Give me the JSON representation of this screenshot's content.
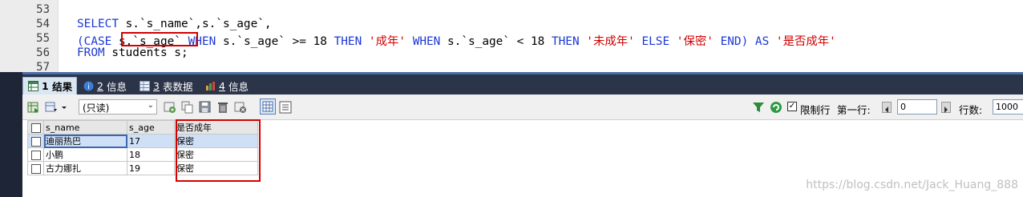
{
  "editor": {
    "line_numbers": [
      "53",
      "54",
      "55",
      "56",
      "57"
    ],
    "line54": {
      "kw1": "SELECT",
      "rest": " s.`s_name`,s.`s_age`,"
    },
    "line55": {
      "p1": "(CASE ",
      "boxed": "s.`s_age`",
      "kw_when1": " WHEN",
      "t1": " s.`s_age` >= 18 ",
      "kw_then1": "THEN",
      "s1": " '成年'",
      "kw_when2": " WHEN",
      "t2": " s.`s_age` < 18 ",
      "kw_then2": "THEN",
      "s2": " '未成年'",
      "kw_else": " ELSE",
      "s3": " '保密'",
      "kw_end": " END)",
      "kw_as": " AS",
      "s4": " '是否成年'"
    },
    "line56": {
      "kw": "FROM",
      "rest": " students s;"
    }
  },
  "tabs": [
    {
      "num": "1",
      "label": "结果",
      "icon": "grid-icon"
    },
    {
      "num": "2",
      "label": "信息",
      "icon": "info-icon"
    },
    {
      "num": "3",
      "label": "表数据",
      "icon": "table-icon"
    },
    {
      "num": "4",
      "label": "信息",
      "icon": "chart-icon"
    }
  ],
  "toolbar": {
    "readonly_label": "(只读)",
    "limit_label": "限制行",
    "first_row_label": "第一行:",
    "first_row_value": "0",
    "rows_label": "行数:",
    "rows_value": "1000",
    "limit_checked": true
  },
  "grid": {
    "columns": [
      "s_name",
      "s_age",
      "是否成年"
    ],
    "rows": [
      [
        "迪丽热巴",
        "17",
        "保密"
      ],
      [
        "小鹏",
        "18",
        "保密"
      ],
      [
        "古力娜扎",
        "19",
        "保密"
      ]
    ]
  },
  "watermark": "https://blog.csdn.net/Jack_Huang_888",
  "colors": {
    "keyword": "#1c37d6",
    "string": "#d20000",
    "highlight_box": "#d40000",
    "tabbar": "#2b3449"
  }
}
